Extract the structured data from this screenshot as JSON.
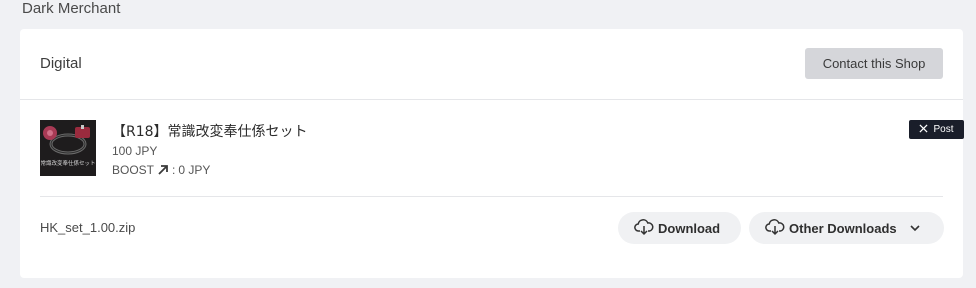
{
  "shop": {
    "name": "Dark Merchant"
  },
  "section": {
    "title": "Digital",
    "contact_label": "Contact this Shop"
  },
  "item": {
    "title": "【R18】常識改変奉仕係セット",
    "price": "100 JPY",
    "boost_label": "BOOST",
    "boost_value": "0 JPY",
    "thumb_text": "常識改変奉仕係セット",
    "post_label": "Post"
  },
  "file": {
    "name": "HK_set_1.00.zip",
    "download_label": "Download",
    "other_label": "Other Downloads"
  },
  "icons": {
    "boost": "arrow-up-right-icon",
    "post": "x-logo-icon",
    "download": "cloud-download-icon",
    "chevron": "chevron-down-icon"
  },
  "colors": {
    "background": "#f0f1f4",
    "card": "#ffffff",
    "contact_button": "#d5d6da",
    "post_button": "#1a1e2a",
    "pill_button": "#f0f1f3"
  }
}
